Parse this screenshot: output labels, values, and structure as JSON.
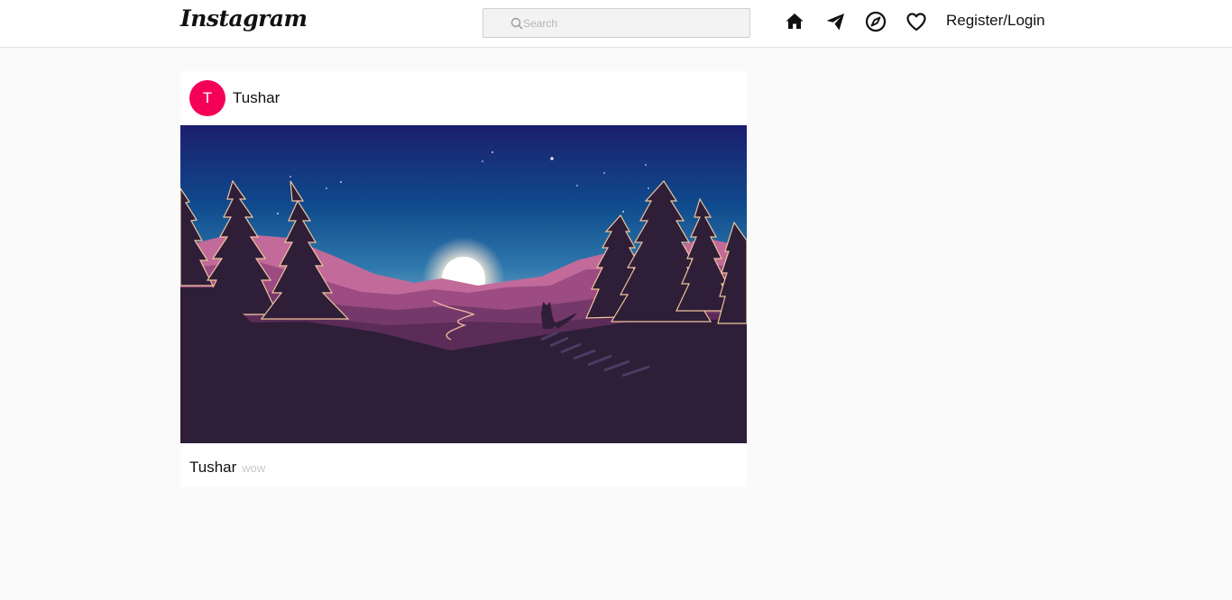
{
  "header": {
    "logo": "Instagram",
    "search": {
      "placeholder": "Search",
      "value": ""
    },
    "nav": {
      "home_icon": "home-icon",
      "direct_icon": "paper-plane-icon",
      "explore_icon": "compass-icon",
      "activity_icon": "heart-icon",
      "login_label": "Register/Login"
    }
  },
  "feed": {
    "posts": [
      {
        "avatar_letter": "T",
        "avatar_color": "#f50057",
        "username": "Tushar",
        "image": "night-forest-landscape-illustration",
        "caption_user": "Tushar",
        "caption_text": "wow"
      }
    ]
  },
  "colors": {
    "page_background": "#fafafa",
    "card_background": "#ffffff",
    "avatar": "#f50057"
  }
}
